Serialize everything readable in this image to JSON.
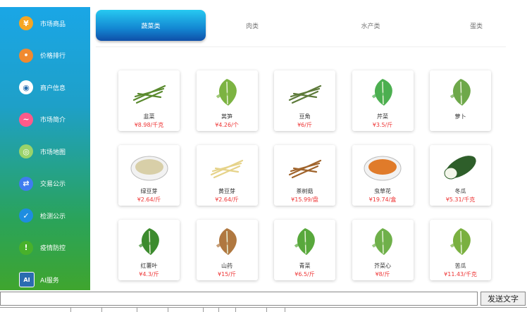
{
  "sidebar": {
    "items": [
      {
        "label": "市场商品",
        "icon": "coin-icon",
        "glyph": "¥",
        "color": "#f5a623"
      },
      {
        "label": "价格排行",
        "icon": "ranking-icon",
        "glyph": "•",
        "color": "#f08a30"
      },
      {
        "label": "商户信息",
        "icon": "merchant-icon",
        "glyph": "◉",
        "color": "#ffffff"
      },
      {
        "label": "市场简介",
        "icon": "chart-icon",
        "glyph": "~",
        "color": "#ff5a8a"
      },
      {
        "label": "市场地图",
        "icon": "map-icon",
        "glyph": "◎",
        "color": "#9ad36a"
      },
      {
        "label": "交易公示",
        "icon": "exchange-icon",
        "glyph": "⇄",
        "color": "#3f7cf0"
      },
      {
        "label": "检测公示",
        "icon": "shield-icon",
        "glyph": "✓",
        "color": "#1e8de0"
      },
      {
        "label": "疫情防控",
        "icon": "alert-icon",
        "glyph": "!",
        "color": "#48b12b"
      },
      {
        "label": "AI服务",
        "icon": "ai-icon",
        "glyph": "AI",
        "color": "#2b6cb0"
      }
    ]
  },
  "tabs": [
    {
      "label": "蔬菜类"
    },
    {
      "label": "肉类"
    },
    {
      "label": "水产类"
    },
    {
      "label": "蛋类"
    }
  ],
  "products": [
    {
      "name": "韭菜",
      "price": "¥8.98/千克",
      "icon": "leek-icon",
      "color": "#5a8a2e"
    },
    {
      "name": "莴笋",
      "price": "¥4.26/个",
      "icon": "lettuce-stem-icon",
      "color": "#7cb342"
    },
    {
      "name": "豆角",
      "price": "¥6/斤",
      "icon": "long-bean-icon",
      "color": "#5d7a3a"
    },
    {
      "name": "芹菜",
      "price": "¥3.5/斤",
      "icon": "celery-icon",
      "color": "#4caf50"
    },
    {
      "name": "萝卜",
      "price": "",
      "icon": "radish-icon",
      "color": "#6ea84a"
    },
    {
      "name": "绿豆芽",
      "price": "¥2.64/斤",
      "icon": "mung-sprout-icon",
      "color": "#d8cfa8"
    },
    {
      "name": "黄豆芽",
      "price": "¥2.64/斤",
      "icon": "soy-sprout-icon",
      "color": "#e6d38a"
    },
    {
      "name": "茶树菇",
      "price": "¥15.99/盘",
      "icon": "mushroom-icon",
      "color": "#a0642c"
    },
    {
      "name": "虫草花",
      "price": "¥19.74/盒",
      "icon": "cordyceps-icon",
      "color": "#e07b2a"
    },
    {
      "name": "冬瓜",
      "price": "¥5.31/千克",
      "icon": "winter-melon-icon",
      "color": "#2e5e2a"
    },
    {
      "name": "红薯叶",
      "price": "¥4.3/斤",
      "icon": "leaf-icon",
      "color": "#3c8b2e"
    },
    {
      "name": "山药",
      "price": "¥15/斤",
      "icon": "yam-icon",
      "color": "#b07840"
    },
    {
      "name": "青菜",
      "price": "¥6.5/斤",
      "icon": "greens-icon",
      "color": "#58a83c"
    },
    {
      "name": "芥菜心",
      "price": "¥8/斤",
      "icon": "mustard-icon",
      "color": "#6fb04a"
    },
    {
      "name": "苦瓜",
      "price": "¥11.43/千克",
      "icon": "bitter-melon-icon",
      "color": "#7ab040"
    }
  ],
  "bottom": {
    "send_label": "发送文字"
  }
}
